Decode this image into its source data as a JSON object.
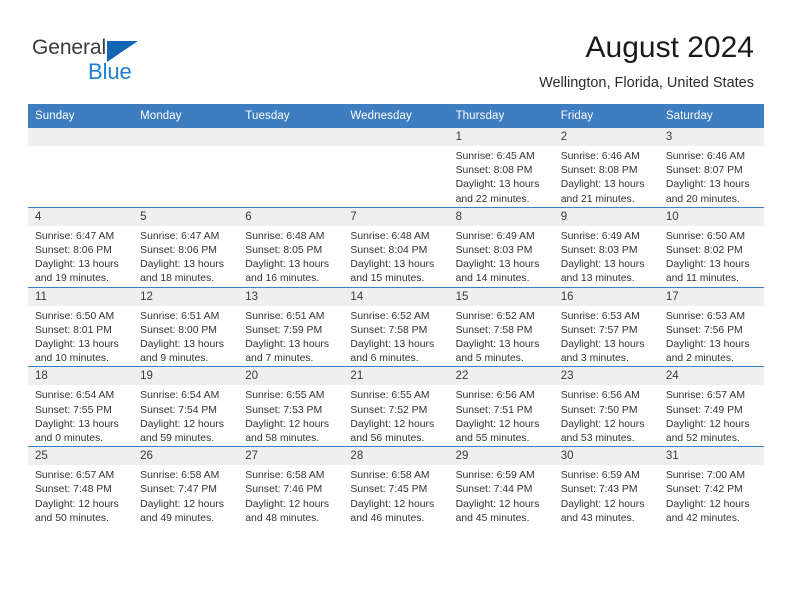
{
  "brand": {
    "name_part1": "General",
    "name_part2": "Blue",
    "accent_color": "#1b7fd4",
    "triangle_color": "#1565b5"
  },
  "header": {
    "title": "August 2024",
    "subtitle": "Wellington, Florida, United States"
  },
  "theme": {
    "header_row_bg": "#3d7dc0",
    "daynum_band_bg": "#efefef",
    "grid_line": "#3d7dc0",
    "text": "#333333"
  },
  "weekday_headers": [
    "Sunday",
    "Monday",
    "Tuesday",
    "Wednesday",
    "Thursday",
    "Friday",
    "Saturday"
  ],
  "labels": {
    "sunrise_prefix": "Sunrise:",
    "sunset_prefix": "Sunset:",
    "daylight_prefix": "Daylight:"
  },
  "weeks": [
    [
      {
        "day": "",
        "empty": true
      },
      {
        "day": "",
        "empty": true
      },
      {
        "day": "",
        "empty": true
      },
      {
        "day": "",
        "empty": true
      },
      {
        "day": "1",
        "sunrise": "Sunrise: 6:45 AM",
        "sunset": "Sunset: 8:08 PM",
        "daylight": "Daylight: 13 hours and 22 minutes."
      },
      {
        "day": "2",
        "sunrise": "Sunrise: 6:46 AM",
        "sunset": "Sunset: 8:08 PM",
        "daylight": "Daylight: 13 hours and 21 minutes."
      },
      {
        "day": "3",
        "sunrise": "Sunrise: 6:46 AM",
        "sunset": "Sunset: 8:07 PM",
        "daylight": "Daylight: 13 hours and 20 minutes."
      }
    ],
    [
      {
        "day": "4",
        "sunrise": "Sunrise: 6:47 AM",
        "sunset": "Sunset: 8:06 PM",
        "daylight": "Daylight: 13 hours and 19 minutes."
      },
      {
        "day": "5",
        "sunrise": "Sunrise: 6:47 AM",
        "sunset": "Sunset: 8:06 PM",
        "daylight": "Daylight: 13 hours and 18 minutes."
      },
      {
        "day": "6",
        "sunrise": "Sunrise: 6:48 AM",
        "sunset": "Sunset: 8:05 PM",
        "daylight": "Daylight: 13 hours and 16 minutes."
      },
      {
        "day": "7",
        "sunrise": "Sunrise: 6:48 AM",
        "sunset": "Sunset: 8:04 PM",
        "daylight": "Daylight: 13 hours and 15 minutes."
      },
      {
        "day": "8",
        "sunrise": "Sunrise: 6:49 AM",
        "sunset": "Sunset: 8:03 PM",
        "daylight": "Daylight: 13 hours and 14 minutes."
      },
      {
        "day": "9",
        "sunrise": "Sunrise: 6:49 AM",
        "sunset": "Sunset: 8:03 PM",
        "daylight": "Daylight: 13 hours and 13 minutes."
      },
      {
        "day": "10",
        "sunrise": "Sunrise: 6:50 AM",
        "sunset": "Sunset: 8:02 PM",
        "daylight": "Daylight: 13 hours and 11 minutes."
      }
    ],
    [
      {
        "day": "11",
        "sunrise": "Sunrise: 6:50 AM",
        "sunset": "Sunset: 8:01 PM",
        "daylight": "Daylight: 13 hours and 10 minutes."
      },
      {
        "day": "12",
        "sunrise": "Sunrise: 6:51 AM",
        "sunset": "Sunset: 8:00 PM",
        "daylight": "Daylight: 13 hours and 9 minutes."
      },
      {
        "day": "13",
        "sunrise": "Sunrise: 6:51 AM",
        "sunset": "Sunset: 7:59 PM",
        "daylight": "Daylight: 13 hours and 7 minutes."
      },
      {
        "day": "14",
        "sunrise": "Sunrise: 6:52 AM",
        "sunset": "Sunset: 7:58 PM",
        "daylight": "Daylight: 13 hours and 6 minutes."
      },
      {
        "day": "15",
        "sunrise": "Sunrise: 6:52 AM",
        "sunset": "Sunset: 7:58 PM",
        "daylight": "Daylight: 13 hours and 5 minutes."
      },
      {
        "day": "16",
        "sunrise": "Sunrise: 6:53 AM",
        "sunset": "Sunset: 7:57 PM",
        "daylight": "Daylight: 13 hours and 3 minutes."
      },
      {
        "day": "17",
        "sunrise": "Sunrise: 6:53 AM",
        "sunset": "Sunset: 7:56 PM",
        "daylight": "Daylight: 13 hours and 2 minutes."
      }
    ],
    [
      {
        "day": "18",
        "sunrise": "Sunrise: 6:54 AM",
        "sunset": "Sunset: 7:55 PM",
        "daylight": "Daylight: 13 hours and 0 minutes."
      },
      {
        "day": "19",
        "sunrise": "Sunrise: 6:54 AM",
        "sunset": "Sunset: 7:54 PM",
        "daylight": "Daylight: 12 hours and 59 minutes."
      },
      {
        "day": "20",
        "sunrise": "Sunrise: 6:55 AM",
        "sunset": "Sunset: 7:53 PM",
        "daylight": "Daylight: 12 hours and 58 minutes."
      },
      {
        "day": "21",
        "sunrise": "Sunrise: 6:55 AM",
        "sunset": "Sunset: 7:52 PM",
        "daylight": "Daylight: 12 hours and 56 minutes."
      },
      {
        "day": "22",
        "sunrise": "Sunrise: 6:56 AM",
        "sunset": "Sunset: 7:51 PM",
        "daylight": "Daylight: 12 hours and 55 minutes."
      },
      {
        "day": "23",
        "sunrise": "Sunrise: 6:56 AM",
        "sunset": "Sunset: 7:50 PM",
        "daylight": "Daylight: 12 hours and 53 minutes."
      },
      {
        "day": "24",
        "sunrise": "Sunrise: 6:57 AM",
        "sunset": "Sunset: 7:49 PM",
        "daylight": "Daylight: 12 hours and 52 minutes."
      }
    ],
    [
      {
        "day": "25",
        "sunrise": "Sunrise: 6:57 AM",
        "sunset": "Sunset: 7:48 PM",
        "daylight": "Daylight: 12 hours and 50 minutes."
      },
      {
        "day": "26",
        "sunrise": "Sunrise: 6:58 AM",
        "sunset": "Sunset: 7:47 PM",
        "daylight": "Daylight: 12 hours and 49 minutes."
      },
      {
        "day": "27",
        "sunrise": "Sunrise: 6:58 AM",
        "sunset": "Sunset: 7:46 PM",
        "daylight": "Daylight: 12 hours and 48 minutes."
      },
      {
        "day": "28",
        "sunrise": "Sunrise: 6:58 AM",
        "sunset": "Sunset: 7:45 PM",
        "daylight": "Daylight: 12 hours and 46 minutes."
      },
      {
        "day": "29",
        "sunrise": "Sunrise: 6:59 AM",
        "sunset": "Sunset: 7:44 PM",
        "daylight": "Daylight: 12 hours and 45 minutes."
      },
      {
        "day": "30",
        "sunrise": "Sunrise: 6:59 AM",
        "sunset": "Sunset: 7:43 PM",
        "daylight": "Daylight: 12 hours and 43 minutes."
      },
      {
        "day": "31",
        "sunrise": "Sunrise: 7:00 AM",
        "sunset": "Sunset: 7:42 PM",
        "daylight": "Daylight: 12 hours and 42 minutes."
      }
    ]
  ]
}
